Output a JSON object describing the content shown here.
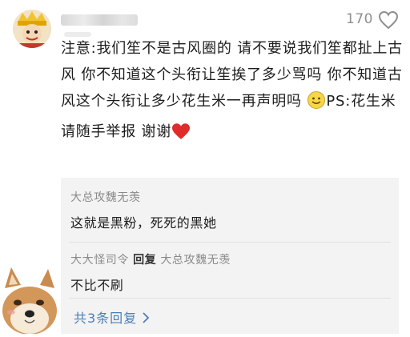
{
  "comment": {
    "likes": "170",
    "text_main": "注意:我们笙不是古风圈的 请不要说我们笙都扯上古风 你不知道这个头衔让笙挨了多少骂吗 你不知道古风这个头衔让多少花生米一再声明吗 ",
    "text_tail": "PS:花生米请随手举报 谢谢",
    "icons": [
      "smiley-face-icon",
      "red-heart-icon"
    ]
  },
  "replies": [
    {
      "author": "大总攻魏无羡",
      "text": "这就是黑粉，死死的黑她"
    },
    {
      "author": "大大怪司令",
      "verb": "回复",
      "target": "大总攻魏无羡",
      "text": "不比不刷"
    }
  ],
  "more_replies_label": "共3条回复",
  "colors": {
    "link": "#4a7fb8",
    "heart": "#e02b2b",
    "reply_bg": "#f3f3f3"
  }
}
